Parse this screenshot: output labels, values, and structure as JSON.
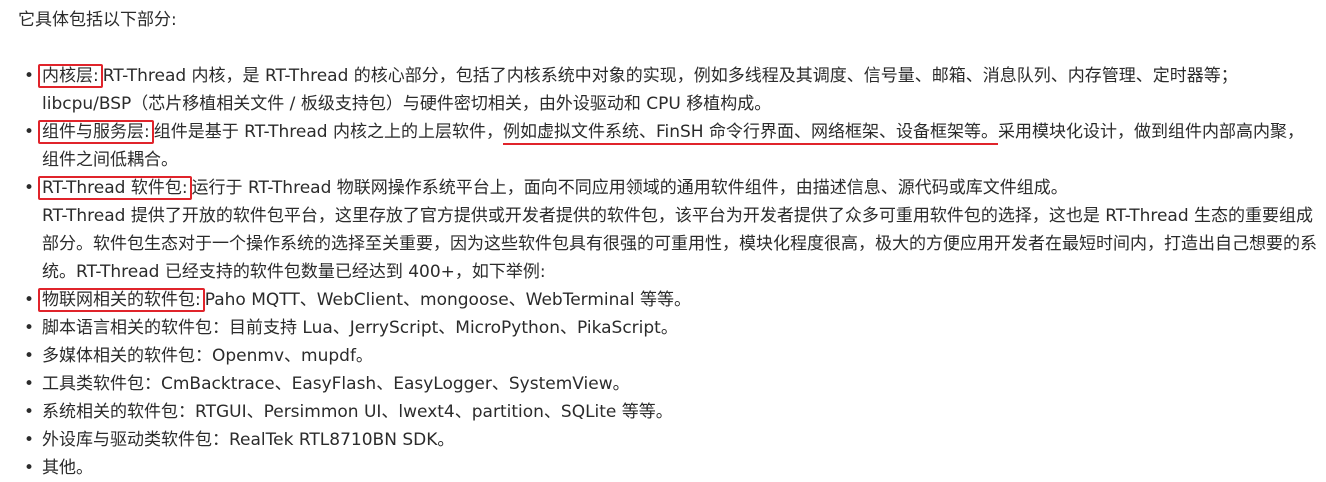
{
  "intro": "它具体包括以下部分:",
  "items": [
    {
      "term": "内核层:",
      "text": "RT-Thread 内核，是 RT-Thread 的核心部分，包括了内核系统中对象的实现，例如多线程及其调度、信号量、邮箱、消息队列、内存管理、定时器等；libcpu/BSP（芯片移植相关文件 / 板级支持包）与硬件密切相关，由外设驱动和 CPU 移植构成。"
    },
    {
      "term": "组件与服务层:",
      "text_before": "组件是基于 RT-Thread 内核之上的上层软件，",
      "text_underlined": "例如虚拟文件系统、FinSH 命令行界面、网络框架、设备框架等。",
      "text_after": "采用模块化设计，做到组件内部高内聚，组件之间低耦合。"
    },
    {
      "term": "RT-Thread 软件包:",
      "text": "运行于 RT-Thread 物联网操作系统平台上，面向不同应用领域的通用软件组件，由描述信息、源代码或库文件组成。",
      "text2": "RT-Thread 提供了开放的软件包平台，这里存放了官方提供或开发者提供的软件包，该平台为开发者提供了众多可重用软件包的选择，这也是 RT-Thread 生态的重要组成部分。软件包生态对于一个操作系统的选择至关重要，因为这些软件包具有很强的可重用性，模块化程度很高，极大的方便应用开发者在最短时间内，打造出自己想要的系统。RT-Thread 已经支持的软件包数量已经达到 400+，如下举例:"
    },
    {
      "term": "物联网相关的软件包:",
      "text": "Paho MQTT、WebClient、mongoose、WebTerminal 等等。"
    },
    {
      "text": "脚本语言相关的软件包：目前支持 Lua、JerryScript、MicroPython、PikaScript。"
    },
    {
      "text": "多媒体相关的软件包：Openmv、mupdf。"
    },
    {
      "text": "工具类软件包：CmBacktrace、EasyFlash、EasyLogger、SystemView。"
    },
    {
      "text": "系统相关的软件包：RTGUI、Persimmon UI、lwext4、partition、SQLite 等等。"
    },
    {
      "text": "外设库与驱动类软件包：RealTek RTL8710BN SDK。"
    },
    {
      "text": "其他。"
    }
  ]
}
